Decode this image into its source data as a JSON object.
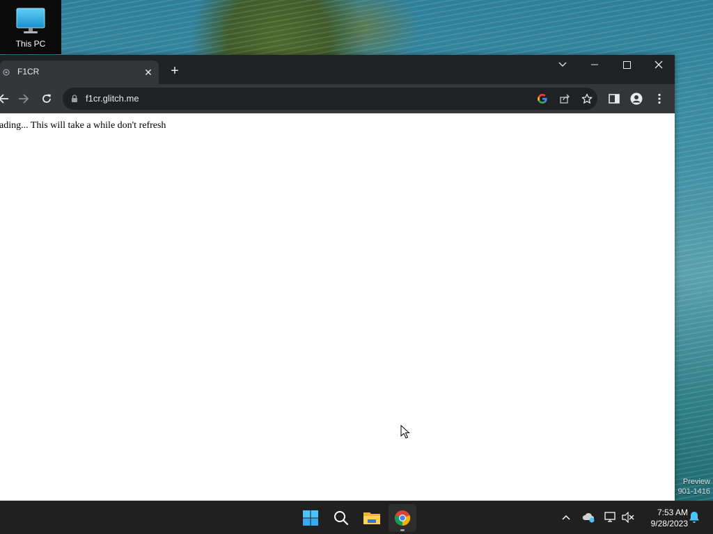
{
  "desktop": {
    "icon_label": "This PC",
    "watermark_line1": "Preview",
    "watermark_line2": "901-1416"
  },
  "browser": {
    "tab": {
      "title": "F1CR",
      "close_symbol": "✕"
    },
    "new_tab_symbol": "+",
    "window_controls": {
      "tab_search": "chevron-down-icon",
      "minimize": "minimize-icon",
      "maximize": "maximize-icon",
      "close": "close-icon"
    },
    "omnibox": {
      "url": "f1cr.glitch.me"
    },
    "page": {
      "text": "oading... This will take a while don't refresh"
    }
  },
  "taskbar": {
    "apps": [
      "start-icon",
      "search-icon",
      "file-explorer-icon",
      "chrome-icon"
    ],
    "clock": {
      "time": "7:53 AM",
      "date": "9/28/2023"
    }
  },
  "colors": {
    "tabstrip": "#202124",
    "toolbar": "#35363a",
    "taskbar": "#202020",
    "accent_blue": "#4cc2ff"
  }
}
